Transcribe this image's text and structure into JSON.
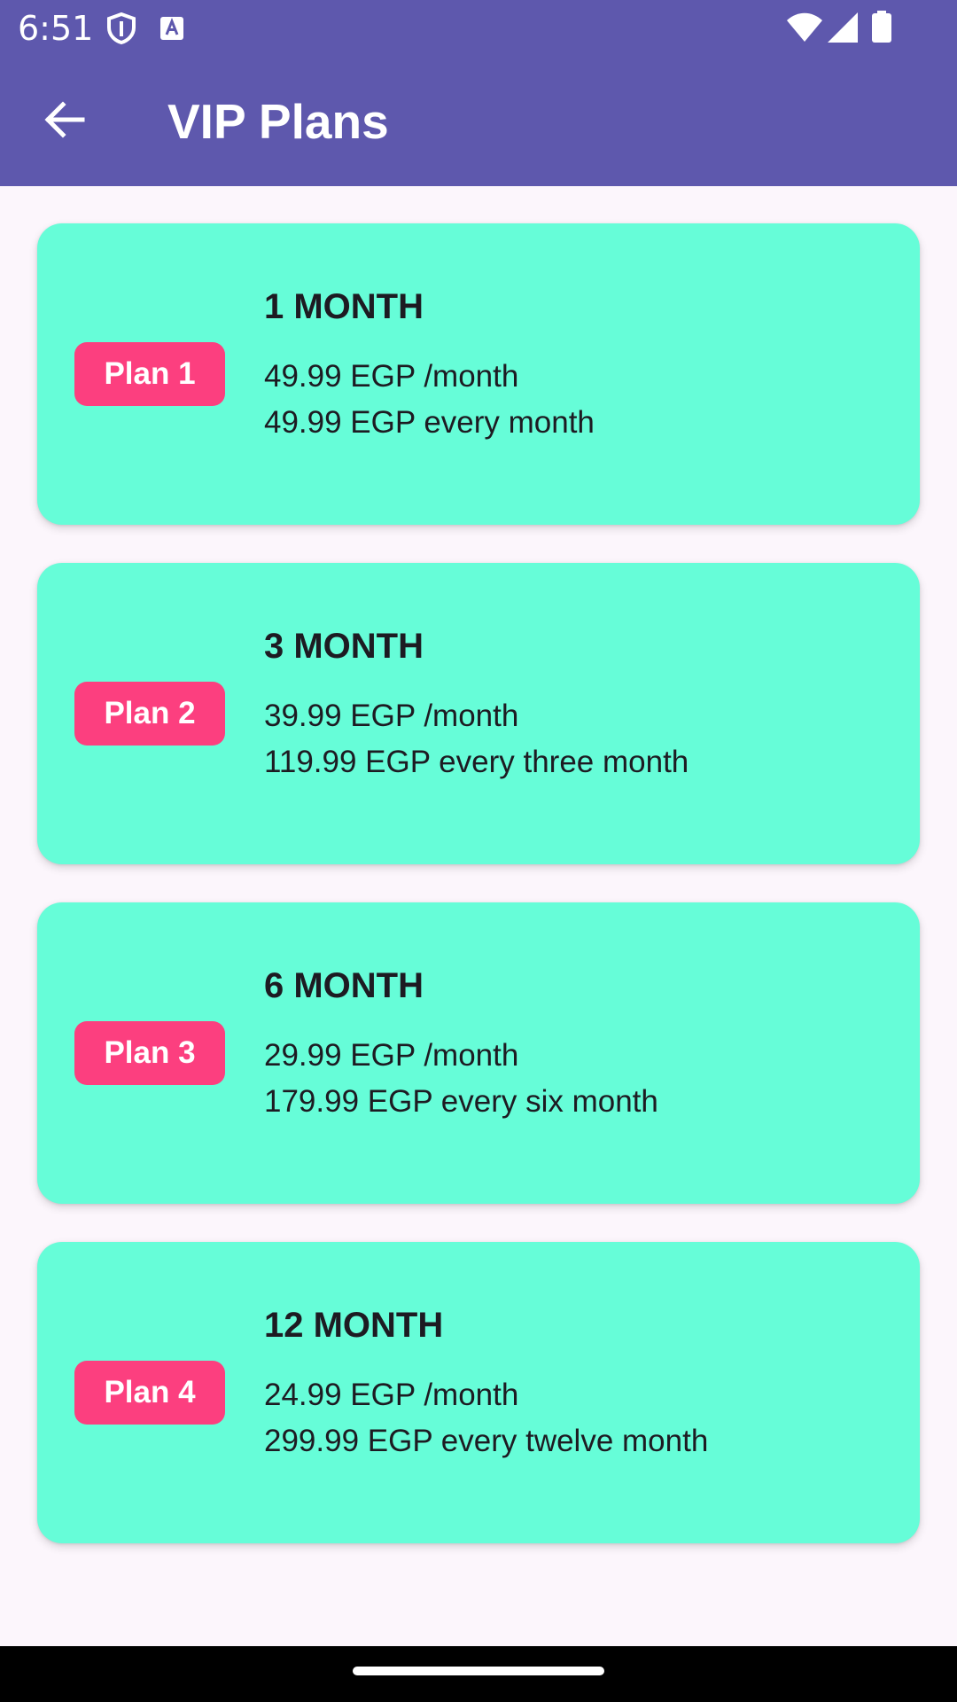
{
  "status_bar": {
    "time": "6:51",
    "icons": [
      "shield-icon",
      "font-icon",
      "wifi-icon",
      "signal-icon",
      "battery-icon"
    ]
  },
  "app_bar": {
    "back_icon": "arrow-left-icon",
    "title": "VIP Plans"
  },
  "plans": [
    {
      "badge": "Plan 1",
      "title": "1 MONTH",
      "monthly": "49.99 EGP /month",
      "total": "49.99 EGP every month"
    },
    {
      "badge": "Plan 2",
      "title": "3 MONTH",
      "monthly": "39.99 EGP /month",
      "total": "119.99 EGP every three month"
    },
    {
      "badge": "Plan 3",
      "title": "6 MONTH",
      "monthly": "29.99 EGP /month",
      "total": "179.99 EGP every six month"
    },
    {
      "badge": "Plan 4",
      "title": "12 MONTH",
      "monthly": "24.99 EGP /month",
      "total": "299.99 EGP every twelve month"
    }
  ],
  "colors": {
    "app_bar": "#5e58ad",
    "background": "#fcf6fc",
    "card": "#66fdd8",
    "badge": "#fc3f7f",
    "text": "#1d1b22"
  }
}
